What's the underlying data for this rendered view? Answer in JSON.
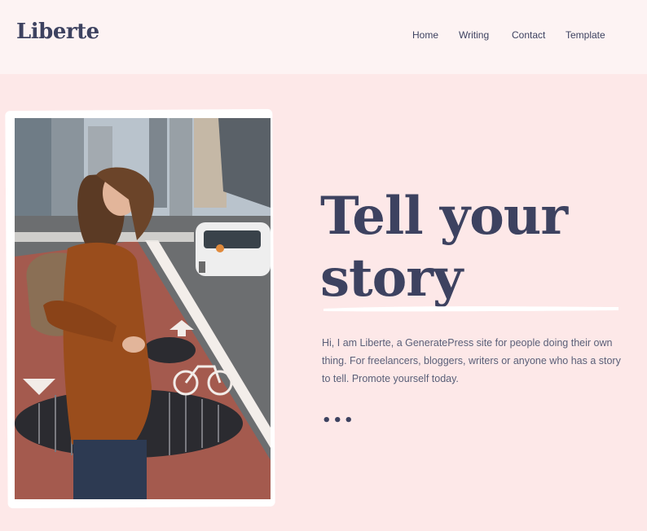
{
  "header": {
    "logo": "Liberte",
    "nav": [
      {
        "label": "Home"
      },
      {
        "label": "Writing"
      },
      {
        "label": "Contact"
      },
      {
        "label": "Template"
      }
    ]
  },
  "hero": {
    "headline_line1": "Tell your",
    "headline_line2": "story",
    "intro": "Hi, I am Liberte, a GeneratePress site for people doing their own thing. For freelancers, bloggers, writers or anyone who has a story to tell. Promote yourself today.",
    "more": "•••",
    "image_icon": "woman-on-bike-lane-photo"
  },
  "colors": {
    "background": "#fde8e8",
    "header_bg": "#fdf3f3",
    "text_dark": "#3d4260",
    "text_body": "#5a5f78"
  }
}
